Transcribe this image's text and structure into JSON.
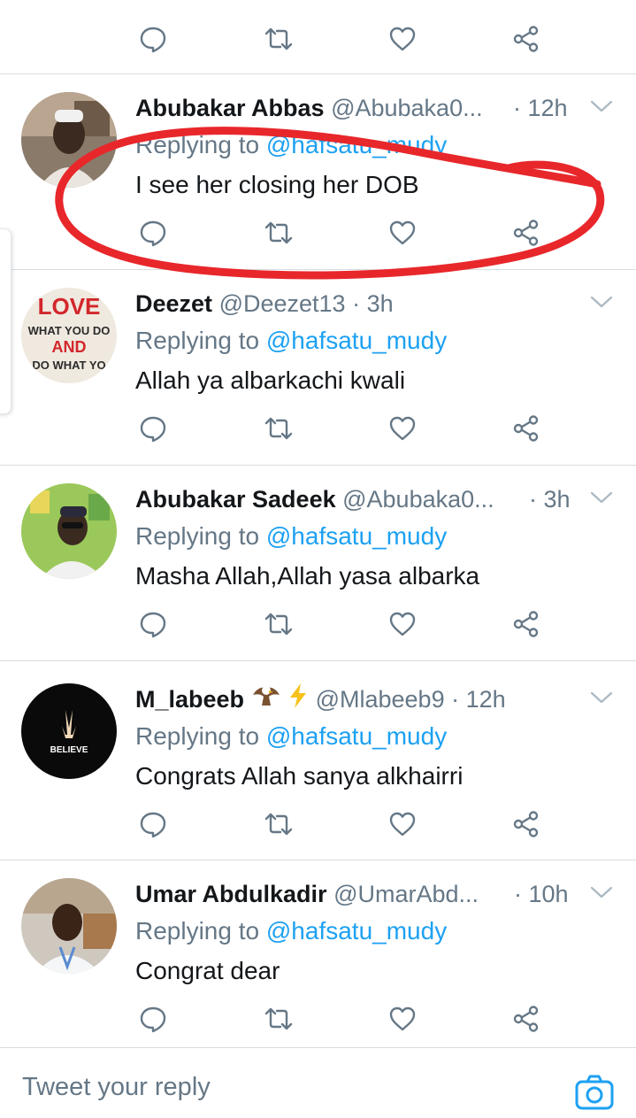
{
  "accent": "#1da1f2",
  "muted": "#657786",
  "annotation_color": "#e8272b",
  "top_actions": {
    "reply": "reply-icon",
    "retweet": "retweet-icon",
    "like": "heart-icon",
    "share": "share-icon"
  },
  "tweets": [
    {
      "name": "Abubakar Abbas",
      "handle": "@Abubaka0...",
      "time": "· 12h",
      "replying_prefix": "Replying to",
      "replying_to": "@hafsatu_mudy",
      "text": "I see her closing her DOB"
    },
    {
      "name": "Deezet",
      "handle": "@Deezet13",
      "time": "· 3h",
      "replying_prefix": "Replying to",
      "replying_to": "@hafsatu_mudy",
      "text": "Allah ya albarkachi kwali",
      "avatar_text": [
        "LOVE",
        "WHAT YOU DO",
        "AND",
        "DO WHAT YO"
      ]
    },
    {
      "name": "Abubakar Sadeek",
      "handle": "@Abubaka0...",
      "time": "· 3h",
      "replying_prefix": "Replying to",
      "replying_to": "@hafsatu_mudy",
      "text": "Masha Allah,Allah yasa albarka"
    },
    {
      "name": "M_labeeb",
      "handle": "@Mlabeeb9",
      "time": "· 12h",
      "replying_prefix": "Replying to",
      "replying_to": "@hafsatu_mudy",
      "text": "Congrats Allah sanya alkhairri",
      "avatar_text": "BELIEVE"
    },
    {
      "name": "Umar Abdulkadir",
      "handle": "@UmarAbd...",
      "time": "· 10h",
      "replying_prefix": "Replying to",
      "replying_to": "@hafsatu_mudy",
      "text": "Congrat dear"
    }
  ],
  "reply_bar": {
    "placeholder": "Tweet your reply",
    "camera": "camera-icon"
  }
}
